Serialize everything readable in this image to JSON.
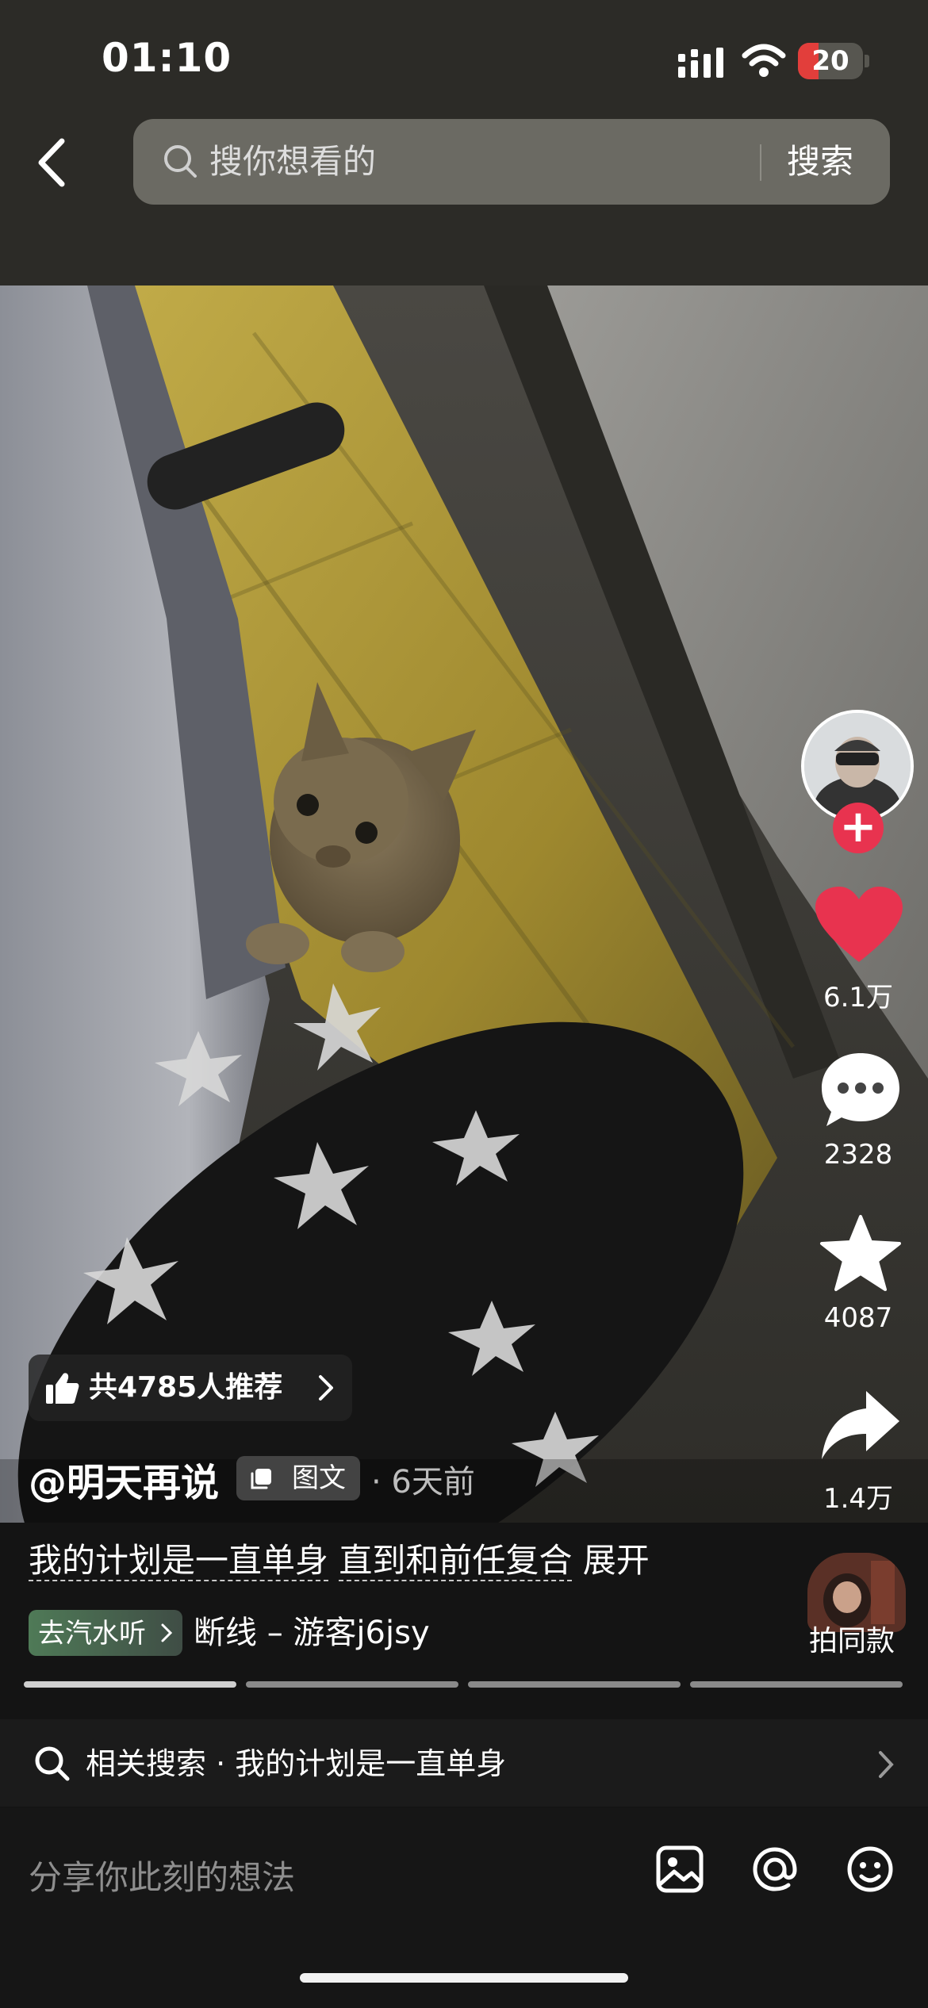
{
  "status": {
    "time": "01:10",
    "battery": "20"
  },
  "search": {
    "placeholder": "搜你想看的",
    "button": "搜索"
  },
  "rail": {
    "likes": "6.1万",
    "comments": "2328",
    "favorites": "4087",
    "shares": "1.4万"
  },
  "post": {
    "recommend": "共4785人推荐",
    "author": "@明天再说",
    "type": "图文",
    "time": "· 6天前",
    "caption_a": "我的计划是一直单身",
    "caption_b": "直到和前任复合",
    "expand": "展开",
    "music_tag": "去汽水听",
    "music": "断线 – 游客j6jsy",
    "same_style": "拍同款"
  },
  "related": {
    "text": "相关搜索 · 我的计划是一直单身"
  },
  "comment": {
    "placeholder": "分享你此刻的想法"
  },
  "progress": {
    "segments": 4,
    "current": 1
  },
  "colors": {
    "like": "#e8334f",
    "status_battery": "#e23e3b",
    "background": "#141414"
  },
  "icons": [
    "back-icon",
    "search-icon",
    "heart-icon",
    "comment-icon",
    "star-icon",
    "share-icon",
    "image-icon",
    "at-icon",
    "emoji-icon",
    "plus-icon",
    "chevron-right-icon",
    "thumbs-up-icon"
  ]
}
